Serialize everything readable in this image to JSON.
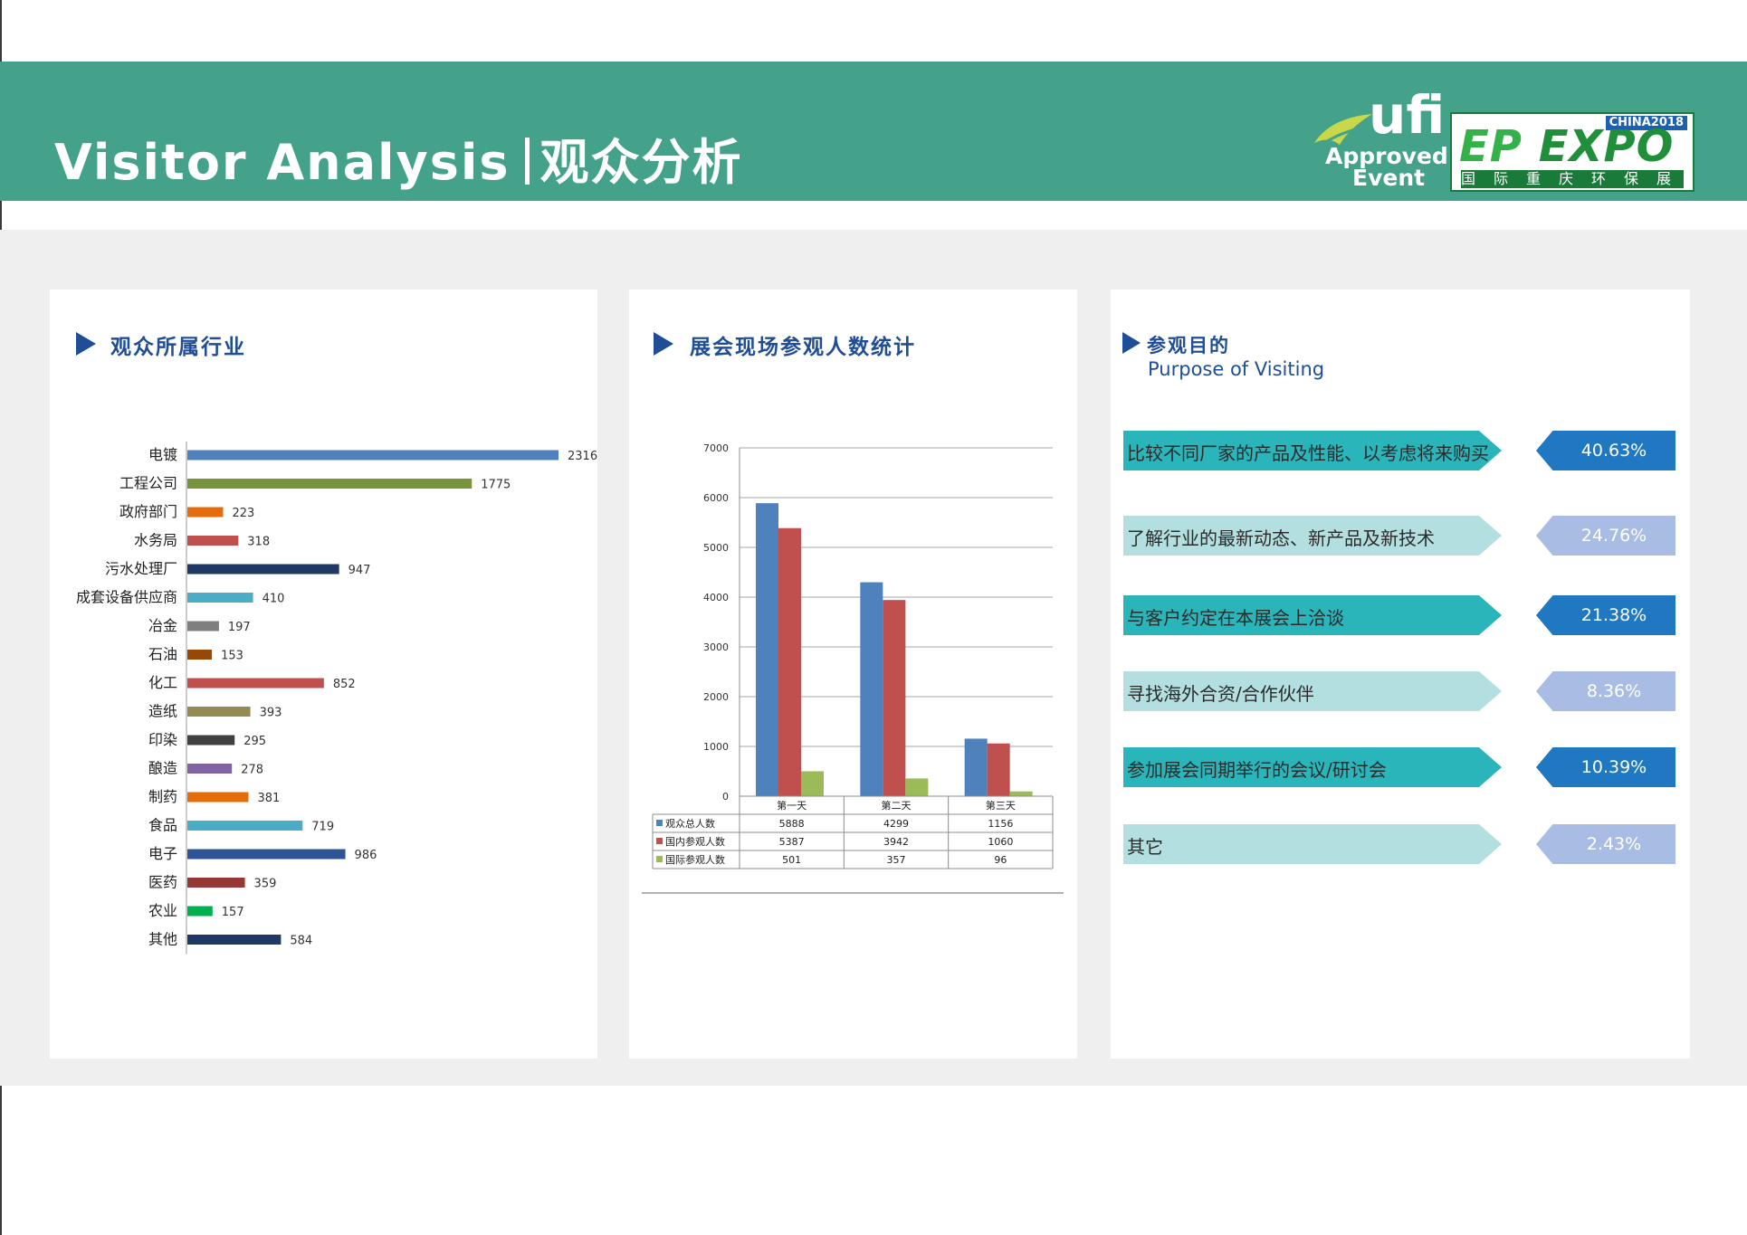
{
  "header": {
    "title_en": "Visitor Analysis",
    "title_cn": "观众分析",
    "ufi_logo": {
      "word": "ufi",
      "line1": "Approved",
      "line2": "Event"
    },
    "ep_logo": {
      "badge": "CHINA2018",
      "main_ep": "EP",
      "main_expo": "EXPO",
      "sub": "国际重庆环保展"
    }
  },
  "panel_industry": {
    "title": "观众所属行业"
  },
  "panel_attendance": {
    "title": "展会现场参观人数统计"
  },
  "panel_purpose": {
    "title": "参观目的",
    "subtitle": "Purpose of Visiting",
    "items": [
      {
        "label": "比较不同厂家的产品及性能、以考虑将来购买",
        "pct": "40.63%",
        "arrow_color": "#2ab5bb",
        "pct_color": "#1f78c1"
      },
      {
        "label": "了解行业的最新动态、新产品及新技术",
        "pct": "24.76%",
        "arrow_color": "#b3dfe0",
        "pct_color": "#a9bde4"
      },
      {
        "label": "与客户约定在本展会上洽谈",
        "pct": "21.38%",
        "arrow_color": "#2ab5bb",
        "pct_color": "#1f78c1"
      },
      {
        "label": "寻找海外合资/合作伙伴",
        "pct": "8.36%",
        "arrow_color": "#b3dfe0",
        "pct_color": "#a9bde4"
      },
      {
        "label": "参加展会同期举行的会议/研讨会",
        "pct": "10.39%",
        "arrow_color": "#2ab5bb",
        "pct_color": "#1f78c1"
      },
      {
        "label": "其它",
        "pct": "2.43%",
        "arrow_color": "#b3dfe0",
        "pct_color": "#a9bde4"
      }
    ]
  },
  "chart_data": [
    {
      "type": "bar",
      "orientation": "horizontal",
      "title": "观众所属行业",
      "categories": [
        "电镀",
        "工程公司",
        "政府部门",
        "水务局",
        "污水处理厂",
        "成套设备供应商",
        "冶金",
        "石油",
        "化工",
        "造纸",
        "印染",
        "酿造",
        "制药",
        "食品",
        "电子",
        "医药",
        "农业",
        "其他"
      ],
      "values": [
        2316,
        1775,
        223,
        318,
        947,
        410,
        197,
        153,
        852,
        393,
        295,
        278,
        381,
        719,
        986,
        359,
        157,
        584
      ],
      "colors": [
        "#4f81bd",
        "#77933c",
        "#e46c0a",
        "#c0504d",
        "#1f3864",
        "#4bacc6",
        "#7f7f7f",
        "#974706",
        "#c0504d",
        "#948a54",
        "#404040",
        "#8064a2",
        "#e46c0a",
        "#4bacc6",
        "#2f5597",
        "#953735",
        "#00b050",
        "#1f3864"
      ],
      "xlim": [
        0,
        2316
      ]
    },
    {
      "type": "bar",
      "title": "展会现场参观人数统计",
      "categories": [
        "第一天",
        "第二天",
        "第三天"
      ],
      "series": [
        {
          "name": "观众总人数",
          "values": [
            5888,
            4299,
            1156
          ],
          "color": "#4f81bd"
        },
        {
          "name": "国内参观人数",
          "values": [
            5387,
            3942,
            1060
          ],
          "color": "#c0504d"
        },
        {
          "name": "国际参观人数",
          "values": [
            501,
            357,
            96
          ],
          "color": "#9bbb59"
        }
      ],
      "ylim": [
        0,
        7000
      ],
      "yticks": [
        0,
        1000,
        2000,
        3000,
        4000,
        5000,
        6000,
        7000
      ],
      "grid": true,
      "data_table": true
    }
  ]
}
